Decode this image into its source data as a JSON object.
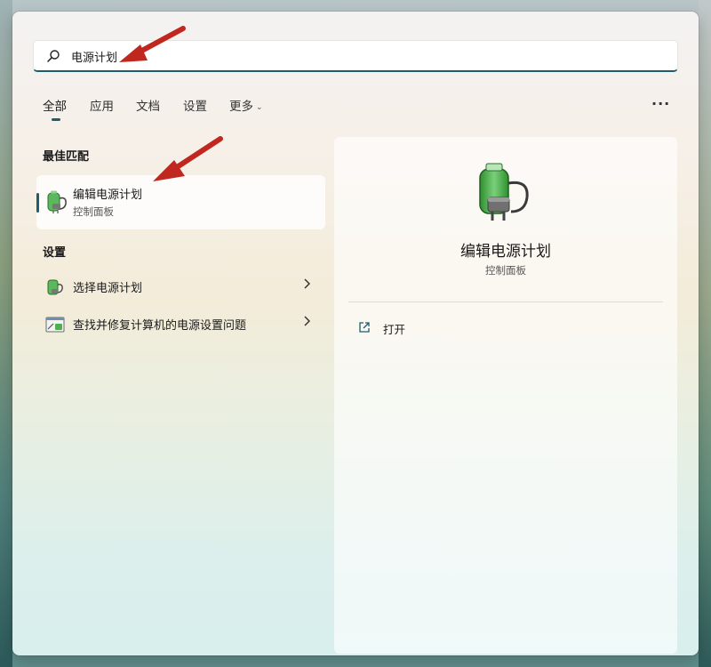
{
  "search": {
    "query": "电源计划"
  },
  "tabs": {
    "all": "全部",
    "apps": "应用",
    "documents": "文档",
    "settings": "设置",
    "more": "更多"
  },
  "more_options": "···",
  "best_match": {
    "section": "最佳匹配",
    "title": "编辑电源计划",
    "subtitle": "控制面板"
  },
  "settings_section": {
    "label": "设置",
    "items": [
      {
        "label": "选择电源计划"
      },
      {
        "label": "查找并修复计算机的电源设置问题"
      }
    ]
  },
  "detail": {
    "title": "编辑电源计划",
    "subtitle": "控制面板",
    "action_open": "打开"
  },
  "colors": {
    "accent": "#1f5d6e",
    "annotation_arrow": "#c0281f"
  },
  "icons": {
    "search": "search-icon",
    "battery_plug": "battery-plug-icon",
    "troubleshoot": "troubleshoot-icon",
    "open": "open-external-icon"
  }
}
